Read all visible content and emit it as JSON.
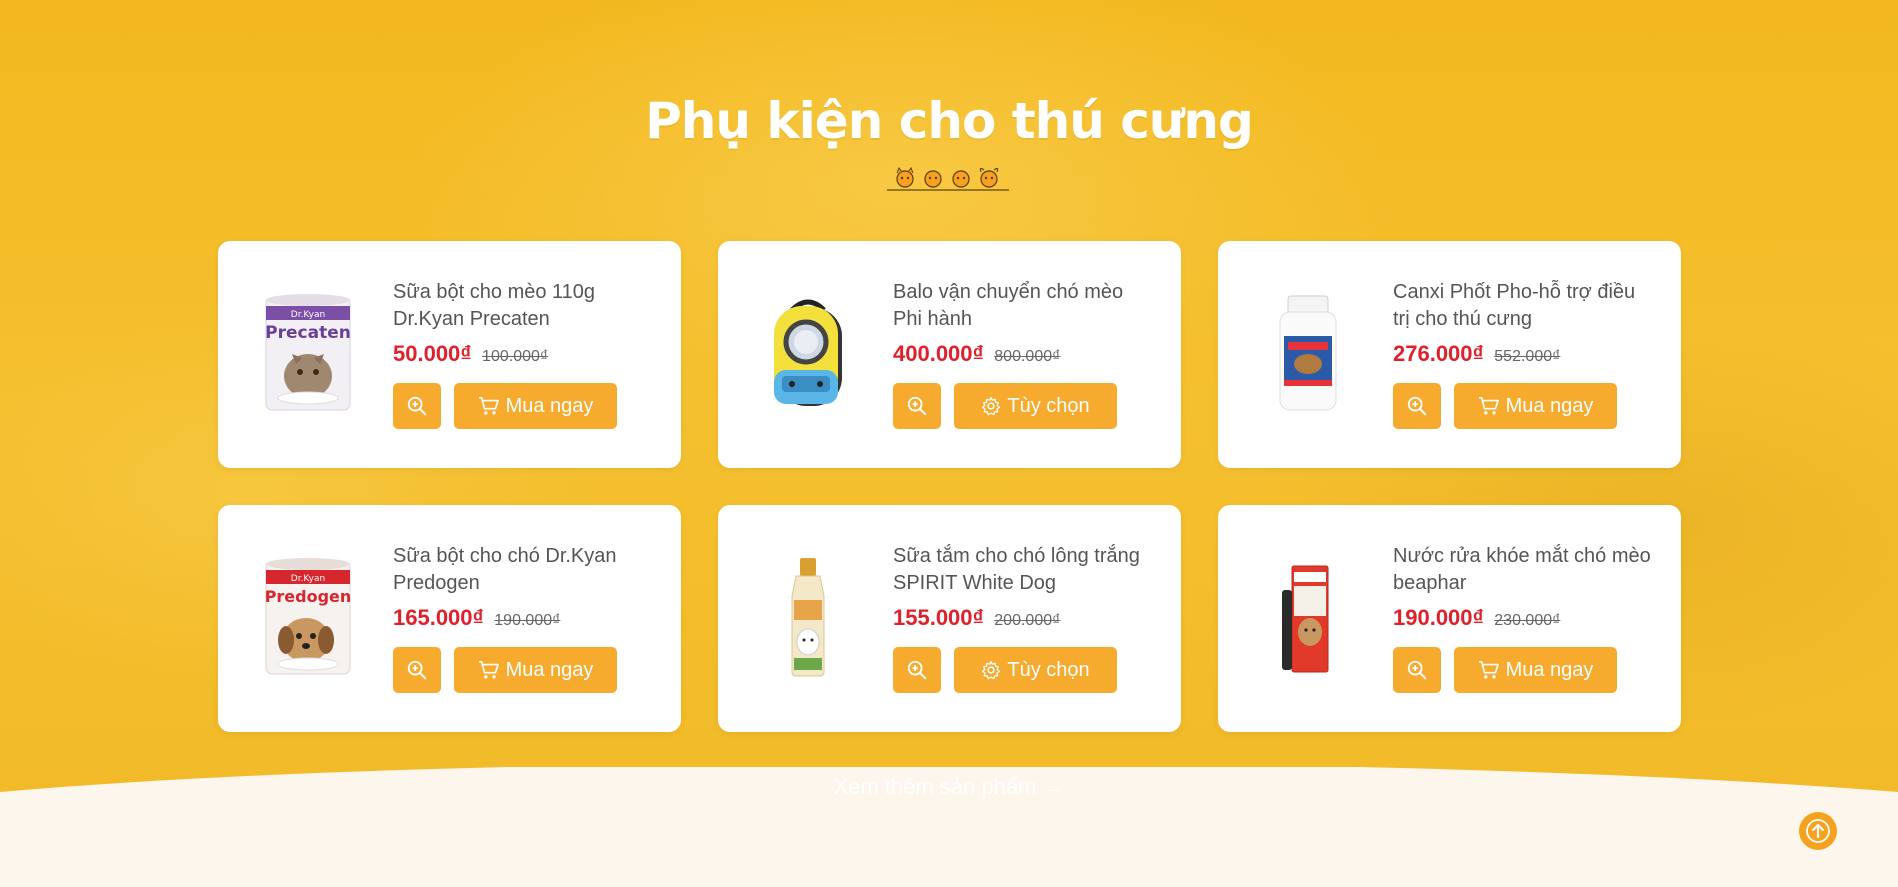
{
  "section": {
    "title": "Phụ kiện cho thú cưng",
    "more_link": "Xem thêm sản phẩm →"
  },
  "colors": {
    "background": "#f6bd2b",
    "button": "#f7ab2e",
    "price": "#e0202a",
    "card": "#ffffff"
  },
  "products": [
    {
      "name": "Sữa bột cho mèo 110g Dr.Kyan Precaten",
      "price": "50.000₫",
      "old_price": "100.000₫",
      "action_label": "Mua ngay",
      "action_icon": "cart-icon",
      "thumb": {
        "brand": "Dr.Kyan",
        "label": "Precaten",
        "icon": "milk-can-cat"
      }
    },
    {
      "name": "Balo vận chuyển chó mèo Phi hành",
      "price": "400.000₫",
      "old_price": "800.000₫",
      "action_label": "Tùy chọn",
      "action_icon": "gear-icon",
      "thumb": {
        "icon": "pet-backpack"
      }
    },
    {
      "name": "Canxi Phốt Pho-hỗ trợ điều trị cho thú cưng",
      "price": "276.000₫",
      "old_price": "552.000₫",
      "action_label": "Mua ngay",
      "action_icon": "cart-icon",
      "thumb": {
        "icon": "supplement-bottle"
      }
    },
    {
      "name": "Sữa bột cho chó Dr.Kyan Predogen",
      "price": "165.000₫",
      "old_price": "190.000₫",
      "action_label": "Mua ngay",
      "action_icon": "cart-icon",
      "thumb": {
        "brand": "Dr.Kyan",
        "label": "Predogen",
        "icon": "milk-can-dog"
      }
    },
    {
      "name": "Sữa tắm cho chó lông trắng SPIRIT White Dog",
      "price": "155.000₫",
      "old_price": "200.000₫",
      "action_label": "Tùy chọn",
      "action_icon": "gear-icon",
      "thumb": {
        "icon": "shampoo-bottle"
      }
    },
    {
      "name": "Nước rửa khóe mắt chó mèo beaphar",
      "price": "190.000₫",
      "old_price": "230.000₫",
      "action_label": "Mua ngay",
      "action_icon": "cart-icon",
      "thumb": {
        "icon": "eye-cleaner-box"
      }
    }
  ]
}
